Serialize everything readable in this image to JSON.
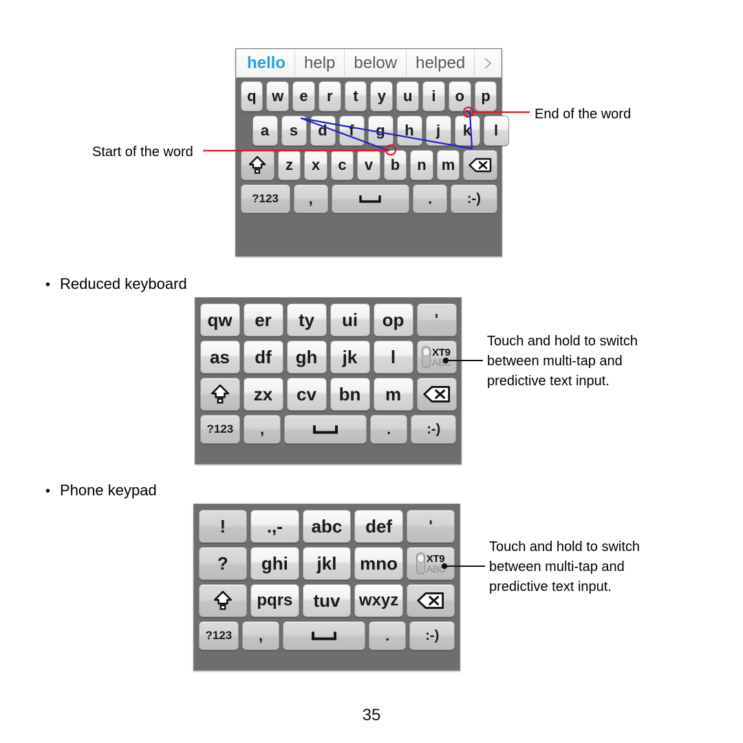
{
  "document": {
    "page_number": "35"
  },
  "qwerty": {
    "suggestions": [
      {
        "text": "hello",
        "active": true
      },
      {
        "text": "help",
        "active": false
      },
      {
        "text": "below",
        "active": false
      },
      {
        "text": "helped",
        "active": false
      }
    ],
    "more_icon": "chevron-right-icon",
    "rows": [
      [
        "q",
        "w",
        "e",
        "r",
        "t",
        "y",
        "u",
        "i",
        "o",
        "p"
      ],
      [
        "a",
        "s",
        "d",
        "f",
        "g",
        "h",
        "j",
        "k",
        "l"
      ],
      [
        "z",
        "x",
        "c",
        "v",
        "b",
        "n",
        "m"
      ],
      [
        "?123",
        ",",
        "⌴",
        ".",
        ":-)"
      ]
    ],
    "shift_icon": "shift-key-icon",
    "backspace_icon": "backspace-key-icon",
    "space_label": "⌴",
    "symbols_label": "?123",
    "comma_label": ",",
    "period_label": ".",
    "smiley_label": ":-)"
  },
  "reduced_keyboard": {
    "heading": "Reduced keyboard",
    "bullet": "•",
    "rows": [
      [
        "qw",
        "er",
        "ty",
        "ui",
        "op",
        "'"
      ],
      [
        "as",
        "df",
        "gh",
        "jk",
        "l",
        "XT9"
      ],
      [
        "zx",
        "cv",
        "bn",
        "m"
      ],
      [
        "?123",
        ",",
        "⌴",
        ".",
        ":-)"
      ]
    ],
    "apostrophe_label": "'",
    "xt9_top": "XT9",
    "xt9_bottom": "ABC",
    "shift_icon": "shift-key-icon",
    "backspace_icon": "backspace-key-icon",
    "symbols_label": "?123",
    "comma_label": ",",
    "space_label": "⌴",
    "period_label": ".",
    "smiley_label": ":-)"
  },
  "phone_keypad": {
    "heading": "Phone keypad",
    "bullet": "•",
    "rows": [
      [
        "!",
        ".,-",
        "abc",
        "def",
        "'"
      ],
      [
        "?",
        "ghi",
        "jkl",
        "mno",
        "XT9"
      ],
      [
        "pqrs",
        "tuv",
        "wxyz"
      ],
      [
        "?123",
        ",",
        "⌴",
        ".",
        ":-)"
      ]
    ],
    "exclaim_label": "!",
    "punct_label": ".,-",
    "abc_label": "abc",
    "def_label": "def",
    "apostrophe_label": "'",
    "question_label": "?",
    "ghi_label": "ghi",
    "jkl_label": "jkl",
    "mno_label": "mno",
    "pqrs_label": "pqrs",
    "tuv_label": "tuv",
    "wxyz_label": "wxyz",
    "xt9_top": "XT9",
    "xt9_bottom": "ABC",
    "shift_icon": "shift-key-icon",
    "backspace_icon": "backspace-key-icon",
    "symbols_label": "?123",
    "comma_label": ",",
    "space_label": "⌴",
    "period_label": ".",
    "smiley_label": ":-)"
  },
  "annotations": {
    "start_of_word": "Start of the word",
    "end_of_word": "End of the word",
    "xt9_hint_reduced": "Touch and hold to switch\nbetween multi-tap and\npredictive text input.",
    "xt9_hint_phone": "Touch and hold to switch\nbetween multi-tap and\npredictive text input."
  },
  "colors": {
    "keyboard_background": "#6e6e6e",
    "key_face": "#f2f2f2",
    "key_face_dim": "#d4d4d4",
    "suggestion_active": "#2b9fe0",
    "suggestion_inactive": "#5a5a5a",
    "annotation_leader": "#e8151a",
    "gesture_trace": "#2222cc"
  }
}
